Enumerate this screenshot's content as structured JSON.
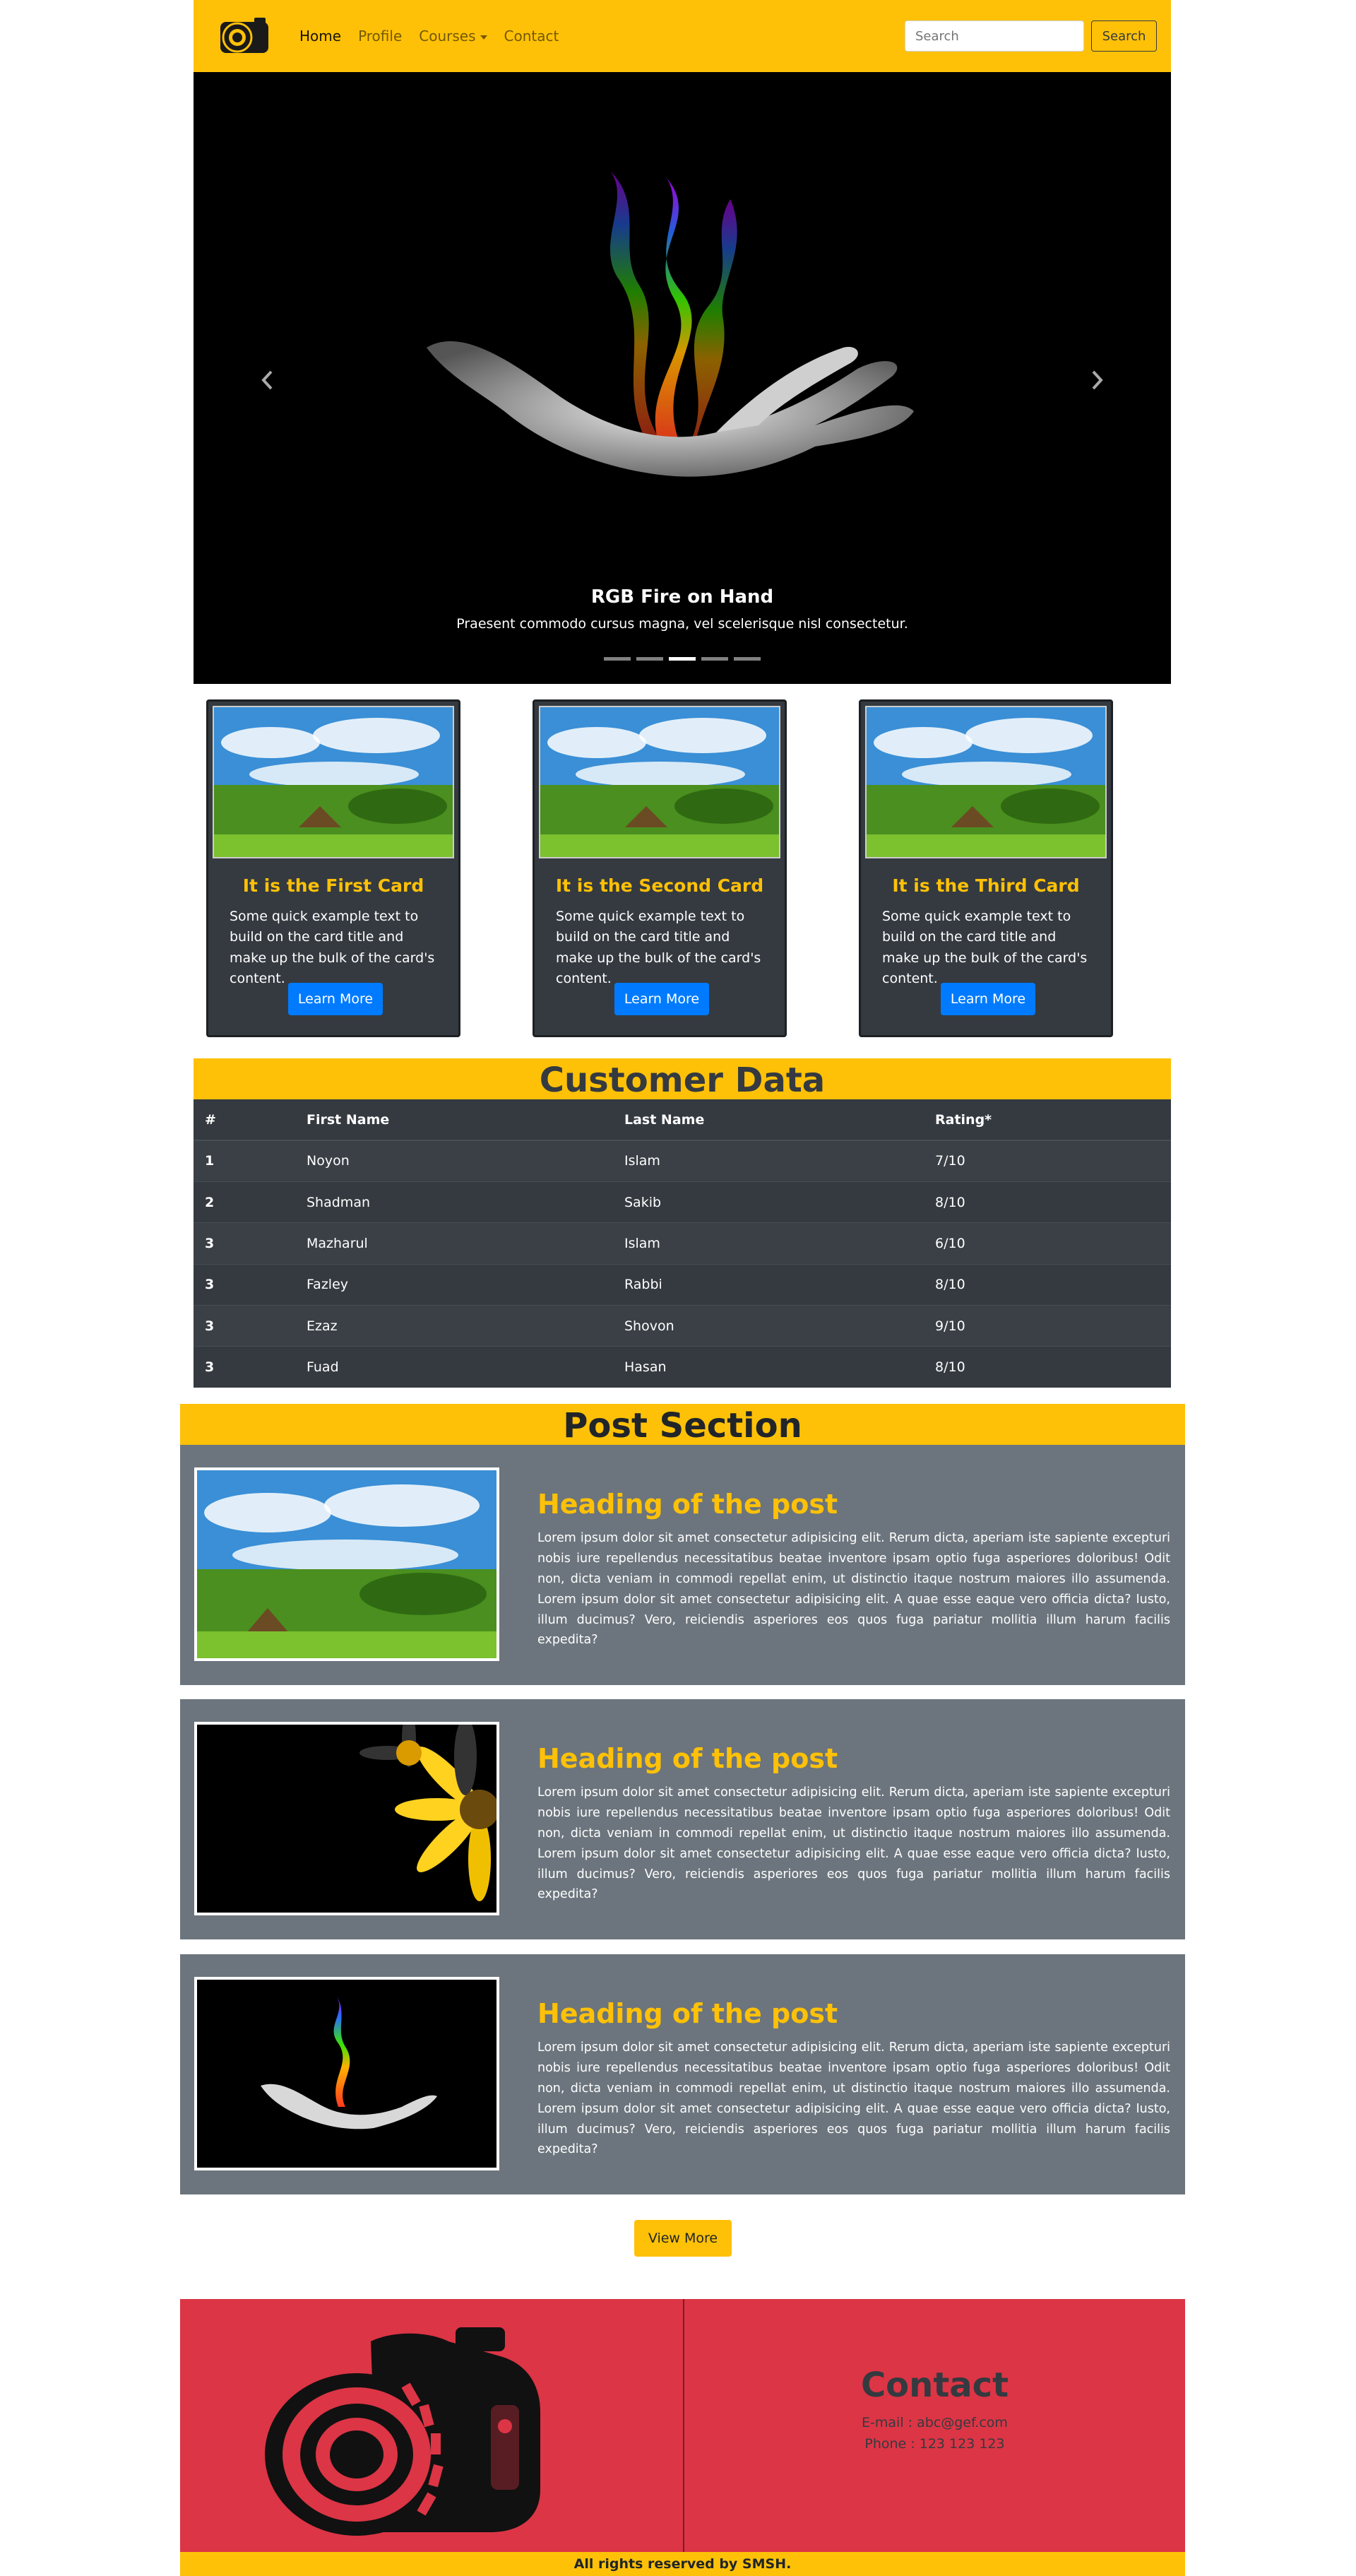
{
  "nav": {
    "links": [
      "Home",
      "Profile",
      "Courses",
      "Contact"
    ],
    "search_placeholder": "Search",
    "search_button": "Search"
  },
  "carousel": {
    "title": "RGB Fire on Hand",
    "text": "Praesent commodo cursus magna, vel scelerisque nisl consectetur.",
    "indicator_count": 5,
    "active_indicator": 3
  },
  "cards": [
    {
      "title": "It is the First Card",
      "text": "Some quick example text to build on the card title and make up the bulk of the card's content.",
      "button": "Learn More"
    },
    {
      "title": "It is the Second Card",
      "text": "Some quick example text to build on the card title and make up the bulk of the card's content.",
      "button": "Learn More"
    },
    {
      "title": "It is the Third Card",
      "text": "Some quick example text to build on the card title and make up the bulk of the card's content.",
      "button": "Learn More"
    }
  ],
  "customer_table": {
    "heading": "Customer Data",
    "columns": [
      "#",
      "First Name",
      "Last Name",
      "Rating*"
    ],
    "rows": [
      [
        "1",
        "Noyon",
        "Islam",
        "7/10"
      ],
      [
        "2",
        "Shadman",
        "Sakib",
        "8/10"
      ],
      [
        "3",
        "Mazharul",
        "Islam",
        "6/10"
      ],
      [
        "3",
        "Fazley",
        "Rabbi",
        "8/10"
      ],
      [
        "3",
        "Ezaz",
        "Shovon",
        "9/10"
      ],
      [
        "3",
        "Fuad",
        "Hasan",
        "8/10"
      ]
    ]
  },
  "posts": {
    "heading": "Post Section",
    "items": [
      {
        "heading": "Heading of the post",
        "text": "Lorem ipsum dolor sit amet consectetur adipisicing elit. Rerum dicta, aperiam iste sapiente excepturi nobis iure repellendus necessitatibus beatae inventore ipsam optio fuga asperiores doloribus! Odit non, dicta veniam in commodi repellat enim, ut distinctio itaque nostrum maiores illo assumenda. Lorem ipsum dolor sit amet consectetur adipisicing elit. A quae esse eaque vero officia dicta? Iusto, illum ducimus? Vero, reiciendis asperiores eos quos fuga pariatur mollitia illum harum facilis expedita?"
      },
      {
        "heading": "Heading of the post",
        "text": "Lorem ipsum dolor sit amet consectetur adipisicing elit. Rerum dicta, aperiam iste sapiente excepturi nobis iure repellendus necessitatibus beatae inventore ipsam optio fuga asperiores doloribus! Odit non, dicta veniam in commodi repellat enim, ut distinctio itaque nostrum maiores illo assumenda. Lorem ipsum dolor sit amet consectetur adipisicing elit. A quae esse eaque vero officia dicta? Iusto, illum ducimus? Vero, reiciendis asperiores eos quos fuga pariatur mollitia illum harum facilis expedita?"
      },
      {
        "heading": "Heading of the post",
        "text": "Lorem ipsum dolor sit amet consectetur adipisicing elit. Rerum dicta, aperiam iste sapiente excepturi nobis iure repellendus necessitatibus beatae inventore ipsam optio fuga asperiores doloribus! Odit non, dicta veniam in commodi repellat enim, ut distinctio itaque nostrum maiores illo assumenda. Lorem ipsum dolor sit amet consectetur adipisicing elit. A quae esse eaque vero officia dicta? Iusto, illum ducimus? Vero, reiciendis asperiores eos quos fuga pariatur mollitia illum harum facilis expedita?"
      }
    ],
    "view_more": "View More"
  },
  "footer": {
    "contact_title": "Contact",
    "email": "E-mail : abc@gef.com",
    "phone": "Phone : 123 123 123",
    "copyright": "All rights reserved by SMSH."
  },
  "colors": {
    "accent": "#ffc107",
    "dark": "#343a40",
    "footer": "#dc3545",
    "button": "#007bff",
    "post_bg": "#6c757d"
  }
}
